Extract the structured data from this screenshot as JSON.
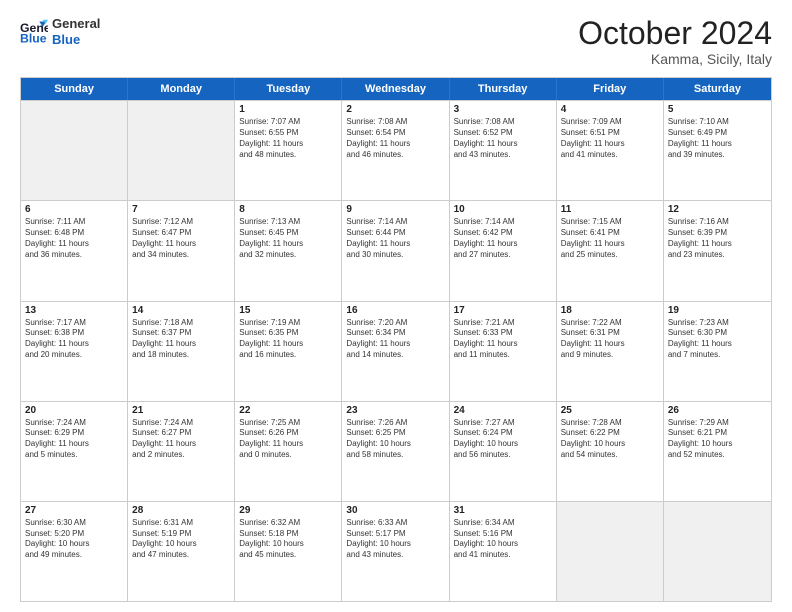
{
  "header": {
    "logo_line1": "General",
    "logo_line2": "Blue",
    "month": "October 2024",
    "location": "Kamma, Sicily, Italy"
  },
  "weekdays": [
    "Sunday",
    "Monday",
    "Tuesday",
    "Wednesday",
    "Thursday",
    "Friday",
    "Saturday"
  ],
  "rows": [
    [
      {
        "day": "",
        "info": "",
        "shaded": true
      },
      {
        "day": "",
        "info": "",
        "shaded": true
      },
      {
        "day": "1",
        "info": "Sunrise: 7:07 AM\nSunset: 6:55 PM\nDaylight: 11 hours\nand 48 minutes."
      },
      {
        "day": "2",
        "info": "Sunrise: 7:08 AM\nSunset: 6:54 PM\nDaylight: 11 hours\nand 46 minutes."
      },
      {
        "day": "3",
        "info": "Sunrise: 7:08 AM\nSunset: 6:52 PM\nDaylight: 11 hours\nand 43 minutes."
      },
      {
        "day": "4",
        "info": "Sunrise: 7:09 AM\nSunset: 6:51 PM\nDaylight: 11 hours\nand 41 minutes."
      },
      {
        "day": "5",
        "info": "Sunrise: 7:10 AM\nSunset: 6:49 PM\nDaylight: 11 hours\nand 39 minutes."
      }
    ],
    [
      {
        "day": "6",
        "info": "Sunrise: 7:11 AM\nSunset: 6:48 PM\nDaylight: 11 hours\nand 36 minutes."
      },
      {
        "day": "7",
        "info": "Sunrise: 7:12 AM\nSunset: 6:47 PM\nDaylight: 11 hours\nand 34 minutes."
      },
      {
        "day": "8",
        "info": "Sunrise: 7:13 AM\nSunset: 6:45 PM\nDaylight: 11 hours\nand 32 minutes."
      },
      {
        "day": "9",
        "info": "Sunrise: 7:14 AM\nSunset: 6:44 PM\nDaylight: 11 hours\nand 30 minutes."
      },
      {
        "day": "10",
        "info": "Sunrise: 7:14 AM\nSunset: 6:42 PM\nDaylight: 11 hours\nand 27 minutes."
      },
      {
        "day": "11",
        "info": "Sunrise: 7:15 AM\nSunset: 6:41 PM\nDaylight: 11 hours\nand 25 minutes."
      },
      {
        "day": "12",
        "info": "Sunrise: 7:16 AM\nSunset: 6:39 PM\nDaylight: 11 hours\nand 23 minutes."
      }
    ],
    [
      {
        "day": "13",
        "info": "Sunrise: 7:17 AM\nSunset: 6:38 PM\nDaylight: 11 hours\nand 20 minutes."
      },
      {
        "day": "14",
        "info": "Sunrise: 7:18 AM\nSunset: 6:37 PM\nDaylight: 11 hours\nand 18 minutes."
      },
      {
        "day": "15",
        "info": "Sunrise: 7:19 AM\nSunset: 6:35 PM\nDaylight: 11 hours\nand 16 minutes."
      },
      {
        "day": "16",
        "info": "Sunrise: 7:20 AM\nSunset: 6:34 PM\nDaylight: 11 hours\nand 14 minutes."
      },
      {
        "day": "17",
        "info": "Sunrise: 7:21 AM\nSunset: 6:33 PM\nDaylight: 11 hours\nand 11 minutes."
      },
      {
        "day": "18",
        "info": "Sunrise: 7:22 AM\nSunset: 6:31 PM\nDaylight: 11 hours\nand 9 minutes."
      },
      {
        "day": "19",
        "info": "Sunrise: 7:23 AM\nSunset: 6:30 PM\nDaylight: 11 hours\nand 7 minutes."
      }
    ],
    [
      {
        "day": "20",
        "info": "Sunrise: 7:24 AM\nSunset: 6:29 PM\nDaylight: 11 hours\nand 5 minutes."
      },
      {
        "day": "21",
        "info": "Sunrise: 7:24 AM\nSunset: 6:27 PM\nDaylight: 11 hours\nand 2 minutes."
      },
      {
        "day": "22",
        "info": "Sunrise: 7:25 AM\nSunset: 6:26 PM\nDaylight: 11 hours\nand 0 minutes."
      },
      {
        "day": "23",
        "info": "Sunrise: 7:26 AM\nSunset: 6:25 PM\nDaylight: 10 hours\nand 58 minutes."
      },
      {
        "day": "24",
        "info": "Sunrise: 7:27 AM\nSunset: 6:24 PM\nDaylight: 10 hours\nand 56 minutes."
      },
      {
        "day": "25",
        "info": "Sunrise: 7:28 AM\nSunset: 6:22 PM\nDaylight: 10 hours\nand 54 minutes."
      },
      {
        "day": "26",
        "info": "Sunrise: 7:29 AM\nSunset: 6:21 PM\nDaylight: 10 hours\nand 52 minutes."
      }
    ],
    [
      {
        "day": "27",
        "info": "Sunrise: 6:30 AM\nSunset: 5:20 PM\nDaylight: 10 hours\nand 49 minutes."
      },
      {
        "day": "28",
        "info": "Sunrise: 6:31 AM\nSunset: 5:19 PM\nDaylight: 10 hours\nand 47 minutes."
      },
      {
        "day": "29",
        "info": "Sunrise: 6:32 AM\nSunset: 5:18 PM\nDaylight: 10 hours\nand 45 minutes."
      },
      {
        "day": "30",
        "info": "Sunrise: 6:33 AM\nSunset: 5:17 PM\nDaylight: 10 hours\nand 43 minutes."
      },
      {
        "day": "31",
        "info": "Sunrise: 6:34 AM\nSunset: 5:16 PM\nDaylight: 10 hours\nand 41 minutes."
      },
      {
        "day": "",
        "info": "",
        "shaded": true
      },
      {
        "day": "",
        "info": "",
        "shaded": true
      }
    ]
  ]
}
